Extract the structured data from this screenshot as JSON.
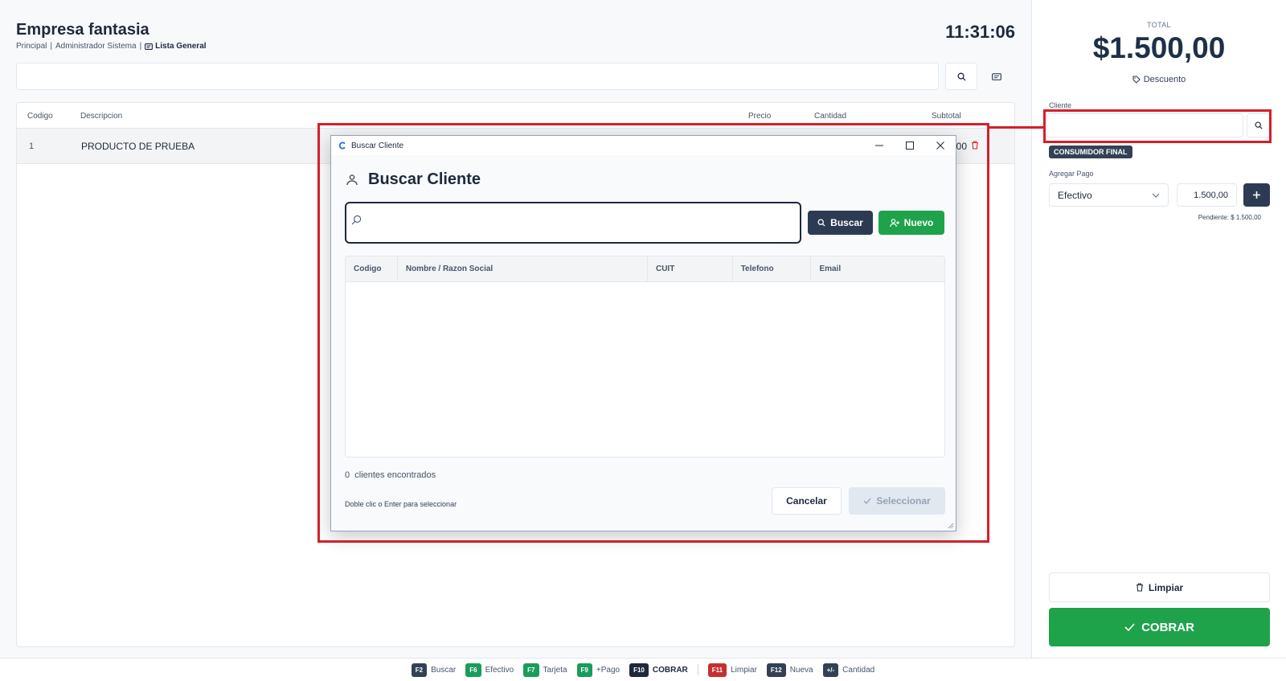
{
  "header": {
    "company": "Empresa fantasia",
    "breadcrumb_branch": "Principal",
    "breadcrumb_user": "Administrador Sistema",
    "breadcrumb_pricelist": "Lista General",
    "clock": "11:31:06"
  },
  "items_table": {
    "columns": {
      "code": "Codigo",
      "description": "Descripcion",
      "price": "Precio",
      "qty": "Cantidad",
      "subtotal": "Subtotal"
    },
    "rows": [
      {
        "code": "1",
        "description": "PRODUCTO DE PRUEBA",
        "subtotal_partial": "00,00"
      }
    ]
  },
  "sidebar": {
    "total_label": "TOTAL",
    "total_value": "$1.500,00",
    "discount_label": "Descuento",
    "client_label": "Cliente",
    "client_value": "",
    "client_badge": "CONSUMIDOR FINAL",
    "payment_label": "Agregar Pago",
    "payment_method": "Efectivo",
    "payment_amount": "1.500,00",
    "pending": "Pendiente: $ 1.500,00",
    "clear_label": "Limpiar",
    "charge_label": "COBRAR"
  },
  "shortcuts": [
    {
      "key": "F2",
      "label": "Buscar",
      "style": "dark"
    },
    {
      "key": "F6",
      "label": "Efectivo",
      "style": "green"
    },
    {
      "key": "F7",
      "label": "Tarjeta",
      "style": "green"
    },
    {
      "key": "F9",
      "label": "+Pago",
      "style": "green"
    },
    {
      "key": "F10",
      "label": "COBRAR",
      "style": "black"
    },
    {
      "key": "F11",
      "label": "Limpiar",
      "style": "red"
    },
    {
      "key": "F12",
      "label": "Nueva",
      "style": "dark"
    },
    {
      "key": "+/-",
      "label": "Cantidad",
      "style": "dark"
    }
  ],
  "dialog": {
    "window_title": "Buscar Cliente",
    "heading": "Buscar Cliente",
    "search_value": "",
    "search_button": "Buscar",
    "new_button": "Nuevo",
    "columns": {
      "code": "Codigo",
      "name": "Nombre / Razon Social",
      "cuit": "CUIT",
      "phone": "Telefono",
      "email": "Email"
    },
    "result_count": "0",
    "result_label": "clientes encontrados",
    "hint": "Doble clic o Enter para seleccionar",
    "cancel_button": "Cancelar",
    "select_button": "Seleccionar"
  },
  "colors": {
    "primary_dark": "#2d3b52",
    "success_green": "#1ea34a",
    "highlight_red": "#d41f2a",
    "key_green": "#1a9c5b",
    "key_red": "#c53030"
  }
}
